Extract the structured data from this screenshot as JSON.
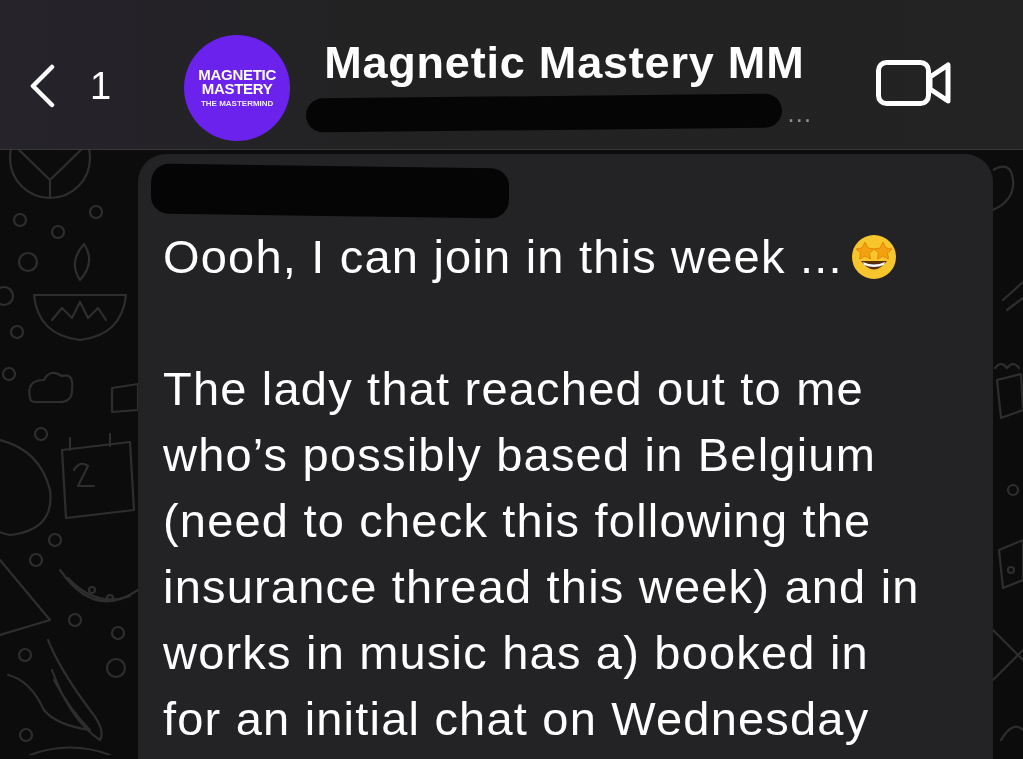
{
  "header": {
    "back": {
      "count": "1"
    },
    "avatar": {
      "lines": [
        "MAGNETIC",
        "MASTERY"
      ],
      "tagline": "THE MASTERMIND"
    },
    "title": "Magnetic Mastery MM",
    "subtitle": {
      "redacted": true,
      "tail": "…"
    }
  },
  "message": {
    "sender_redacted": true,
    "paragraphs": [
      {
        "text": "Oooh, I can join in this week ...",
        "emoji": true
      },
      {
        "text": "The lady that reached out to me\nwho’s possibly based in Belgium\n(need to check this following the\ninsurance thread this week) and in\nworks in music has a) booked in\nfor an initial chat on Wednesday",
        "emoji": false
      }
    ]
  }
}
